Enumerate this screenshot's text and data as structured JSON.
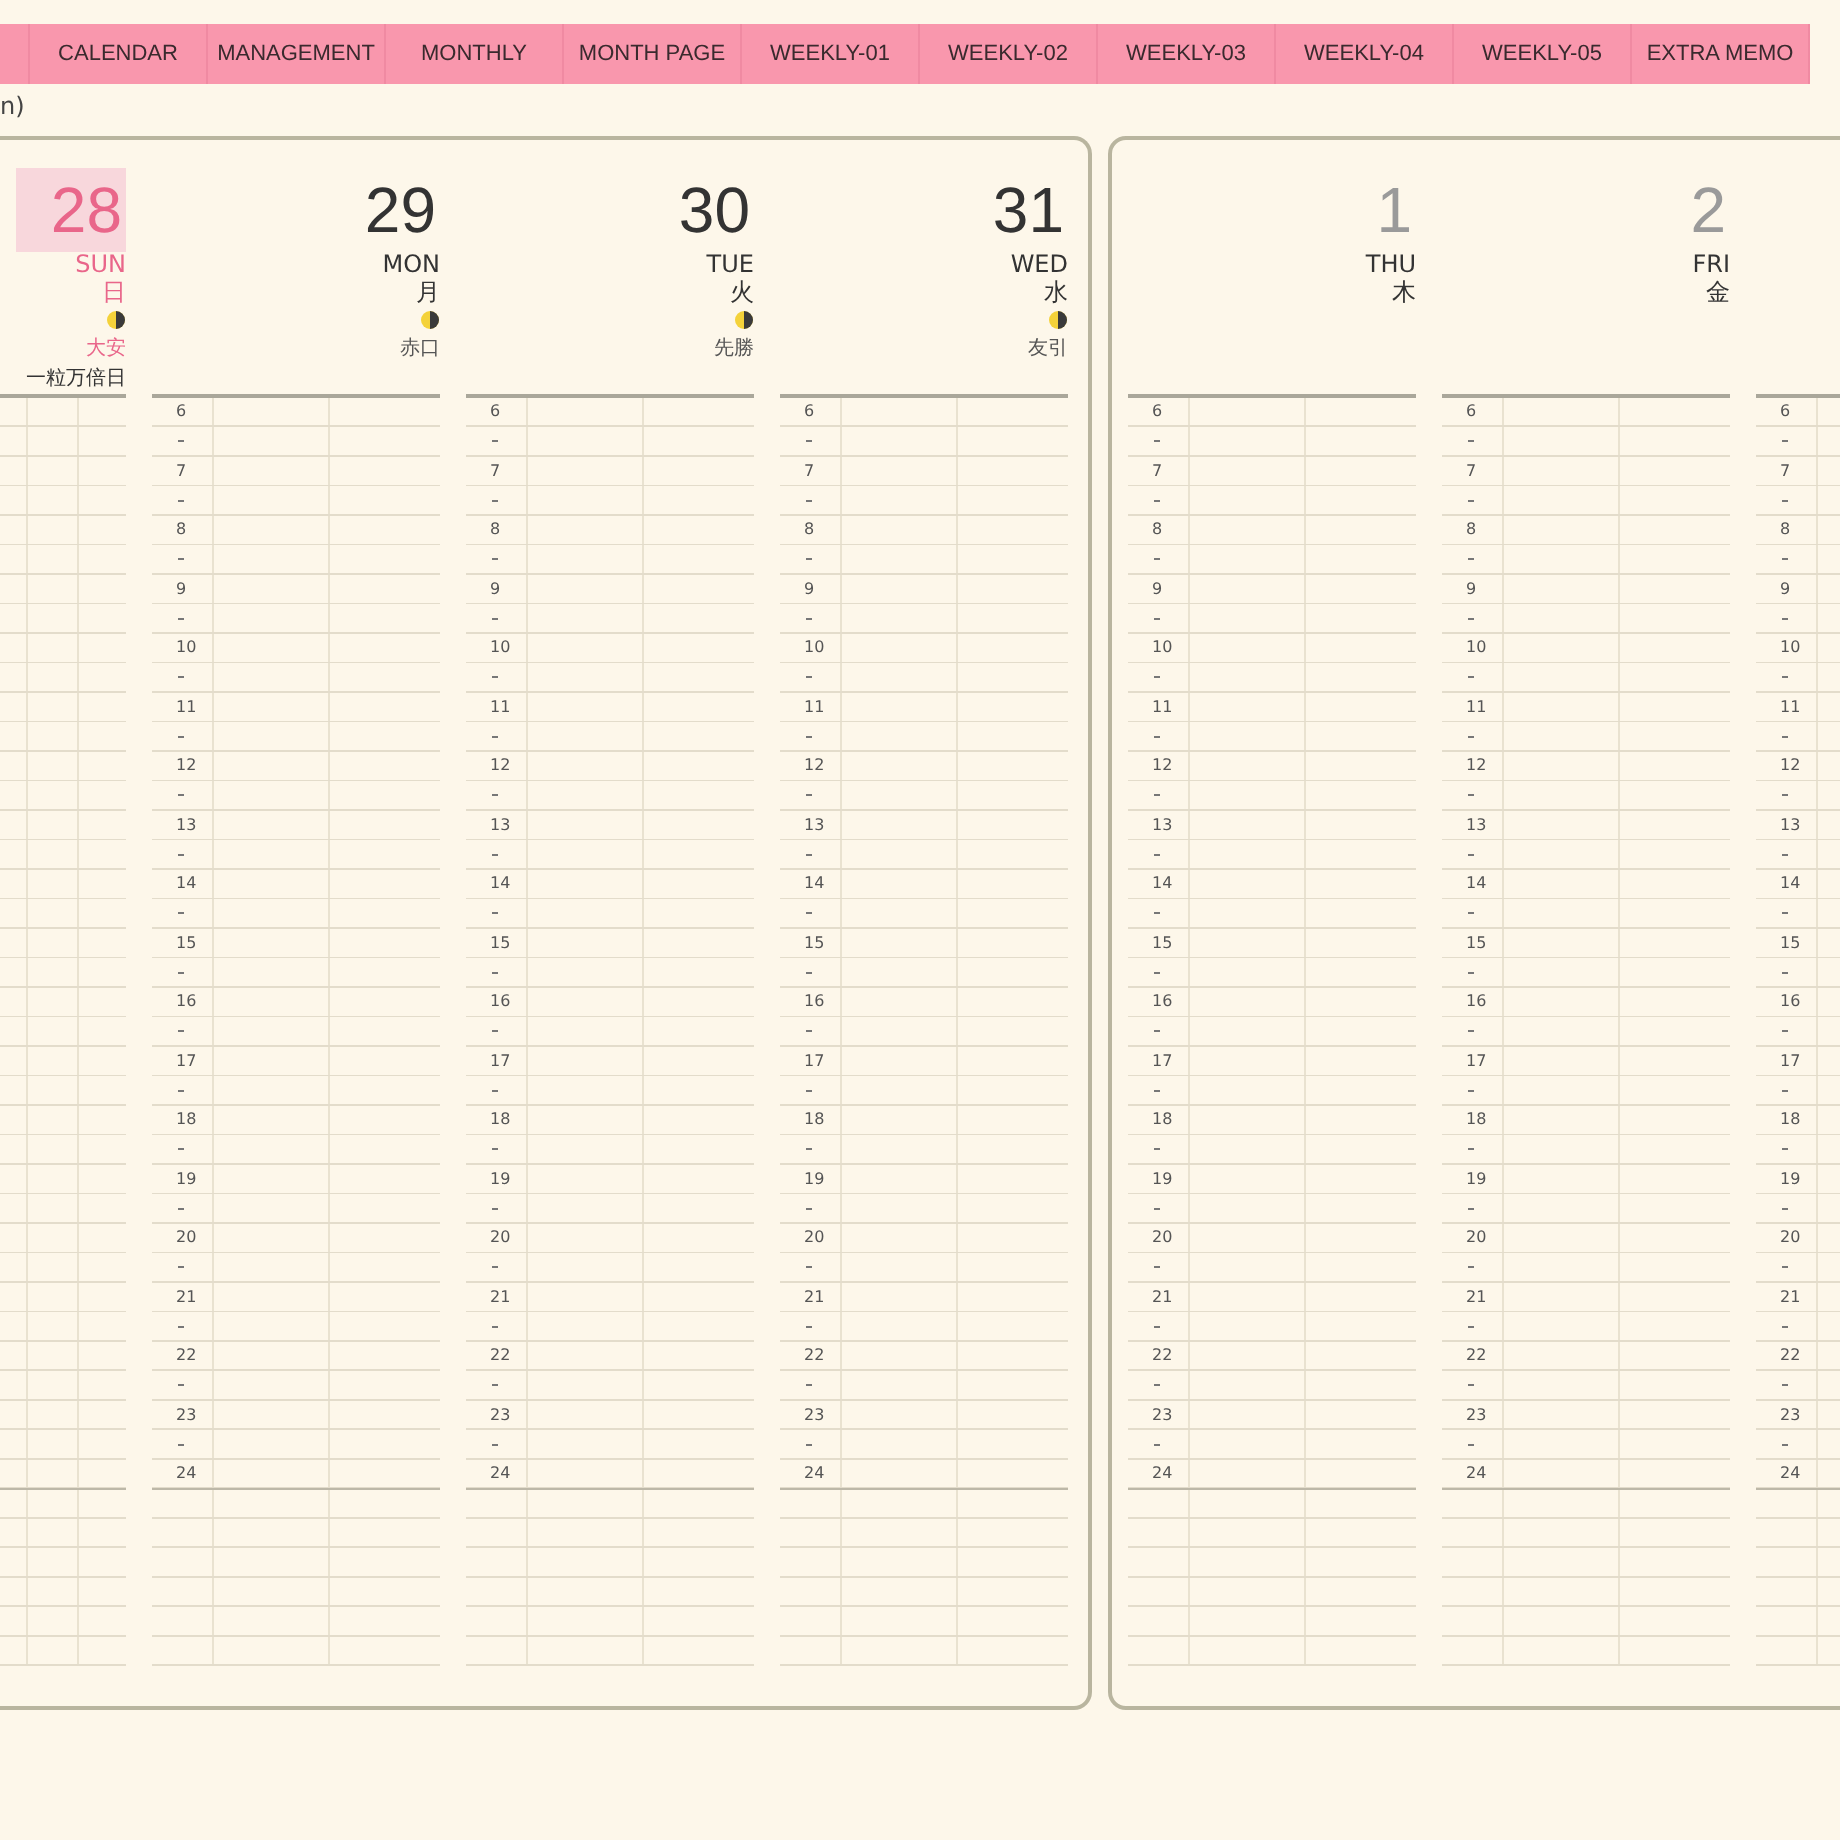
{
  "tabs": [
    {
      "label": "CALENDAR",
      "selected": false
    },
    {
      "label": "MANAGEMENT",
      "selected": false
    },
    {
      "label": "MONTHLY",
      "selected": false
    },
    {
      "label": "MONTH PAGE",
      "selected": false
    },
    {
      "label": "WEEKLY-01",
      "selected": false
    },
    {
      "label": "WEEKLY-02",
      "selected": false
    },
    {
      "label": "WEEKLY-03",
      "selected": false
    },
    {
      "label": "WEEKLY-04",
      "selected": false
    },
    {
      "label": "WEEKLY-05",
      "selected": false
    },
    {
      "label": "EXTRA MEMO",
      "selected": false
    }
  ],
  "heading_fragment": "n)",
  "pages": [
    {
      "days": [
        {
          "date": "28",
          "dow": "SUN",
          "kanji": "日",
          "holiday": true,
          "moon": true,
          "rokuyo": "大安",
          "note": "一粒万倍日"
        },
        {
          "date": "29",
          "dow": "MON",
          "kanji": "月",
          "moon": true,
          "rokuyo": "赤口",
          "hours": [
            "6",
            "7",
            "8",
            "9",
            "10",
            "11",
            "12",
            "13",
            "14",
            "15",
            "16",
            "17",
            "18",
            "19",
            "20",
            "21",
            "22",
            "23",
            "24"
          ]
        },
        {
          "date": "30",
          "dow": "TUE",
          "kanji": "火",
          "moon": true,
          "rokuyo": "先勝",
          "hours": [
            "6",
            "7",
            "8",
            "9",
            "10",
            "11",
            "12",
            "13",
            "14",
            "15",
            "16",
            "17",
            "18",
            "19",
            "20",
            "21",
            "22",
            "23",
            "24"
          ]
        },
        {
          "date": "31",
          "dow": "WED",
          "kanji": "水",
          "moon": true,
          "rokuyo": "友引",
          "hours": [
            "6",
            "7",
            "8",
            "9",
            "10",
            "11",
            "12",
            "13",
            "14",
            "15",
            "16",
            "17",
            "18",
            "19",
            "20",
            "21",
            "22",
            "23",
            "24"
          ]
        }
      ]
    },
    {
      "days": [
        {
          "date": "1",
          "dow": "THU",
          "kanji": "木",
          "other_month": true,
          "hours": [
            "6",
            "7",
            "8",
            "9",
            "10",
            "11",
            "12",
            "13",
            "14",
            "15",
            "16",
            "17",
            "18",
            "19",
            "20",
            "21",
            "22",
            "23",
            "24"
          ]
        },
        {
          "date": "2",
          "dow": "FRI",
          "kanji": "金",
          "other_month": true,
          "hours": [
            "6",
            "7",
            "8",
            "9",
            "10",
            "11",
            "12",
            "13",
            "14",
            "15",
            "16",
            "17",
            "18",
            "19",
            "20",
            "21",
            "22",
            "23",
            "24"
          ]
        },
        {
          "hours": [
            "6",
            "7",
            "8",
            "9",
            "10",
            "11",
            "12",
            "13",
            "14",
            "15",
            "16",
            "17",
            "18",
            "19",
            "20",
            "21",
            "22",
            "23",
            "24"
          ]
        }
      ]
    }
  ]
}
